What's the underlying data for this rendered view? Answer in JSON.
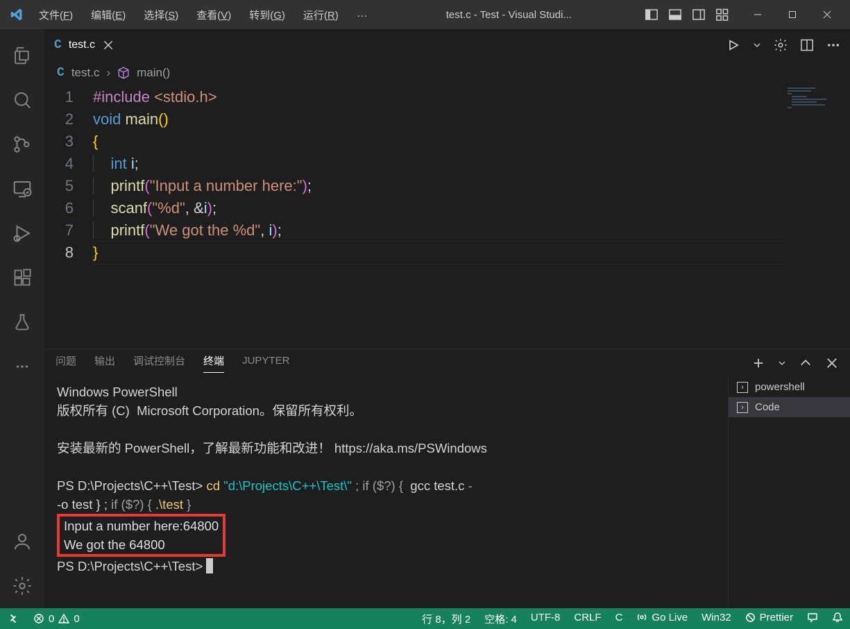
{
  "window": {
    "title": "test.c - Test - Visual Studi..."
  },
  "menu": {
    "items": [
      {
        "pre": "文件(",
        "u": "F",
        "post": ")"
      },
      {
        "pre": "编辑(",
        "u": "E",
        "post": ")"
      },
      {
        "pre": "选择(",
        "u": "S",
        "post": ")"
      },
      {
        "pre": "查看(",
        "u": "V",
        "post": ")"
      },
      {
        "pre": "转到(",
        "u": "G",
        "post": ")"
      },
      {
        "pre": "运行(",
        "u": "R",
        "post": ")"
      }
    ],
    "ellipsis": "…"
  },
  "tab": {
    "name": "test.c"
  },
  "breadcrumb": {
    "file": "test.c",
    "symbol": "main()"
  },
  "code": {
    "lines": [
      "1",
      "2",
      "3",
      "4",
      "5",
      "6",
      "7",
      "8"
    ],
    "include_kw": "#include",
    "include_hdr": "<stdio.h>",
    "void": "void",
    "main": "main",
    "int": "int",
    "i": "i",
    "printf": "printf",
    "scanf": "scanf",
    "str_prompt": "\"Input a number here:\"",
    "str_fmt": "\"%d\"",
    "str_got": "\"We got the %d\"",
    "amp_i": "&i"
  },
  "panel": {
    "tabs": {
      "problems": "问题",
      "output": "输出",
      "debug": "调试控制台",
      "terminal": "终端",
      "jupyter": "JUPYTER"
    }
  },
  "terminal": {
    "line1": "Windows PowerShell",
    "line2": "版权所有 (C)  Microsoft Corporation。保留所有权利。",
    "line3": "安装最新的 PowerShell，了解最新功能和改进！ https://aka.ms/PSWindows",
    "prompt1_pre": "PS ",
    "prompt1_path": "D:\\Projects\\C++\\Test",
    "prompt1_gt": "> ",
    "cmd_cd": "cd",
    "cmd_path": "\"d:\\Projects\\C++\\Test\\\"",
    "cmd_sep": " ; ",
    "cmd_if": "if",
    "cmd_cond": " ($?) { ",
    "cmd_gcc": " gcc test.c ",
    "cmd_dash_o": "-o test } ; ",
    "cmd_if2": "if",
    "cmd_cond2": " ($?) { ",
    "cmd_run": ".\\test",
    "cmd_tail": " }",
    "run_in": "Input a number here:64800",
    "run_out": "We got the 64800",
    "prompt2": "PS D:\\Projects\\C++\\Test> "
  },
  "termside": {
    "powershell": "powershell",
    "code": "Code"
  },
  "status": {
    "errors": "0",
    "warnings": "0",
    "cursor": "行 8，列 2",
    "spaces": "空格: 4",
    "encoding": "UTF-8",
    "eol": "CRLF",
    "lang": "C",
    "golive": "Go Live",
    "win32": "Win32",
    "prettier": "Prettier"
  }
}
